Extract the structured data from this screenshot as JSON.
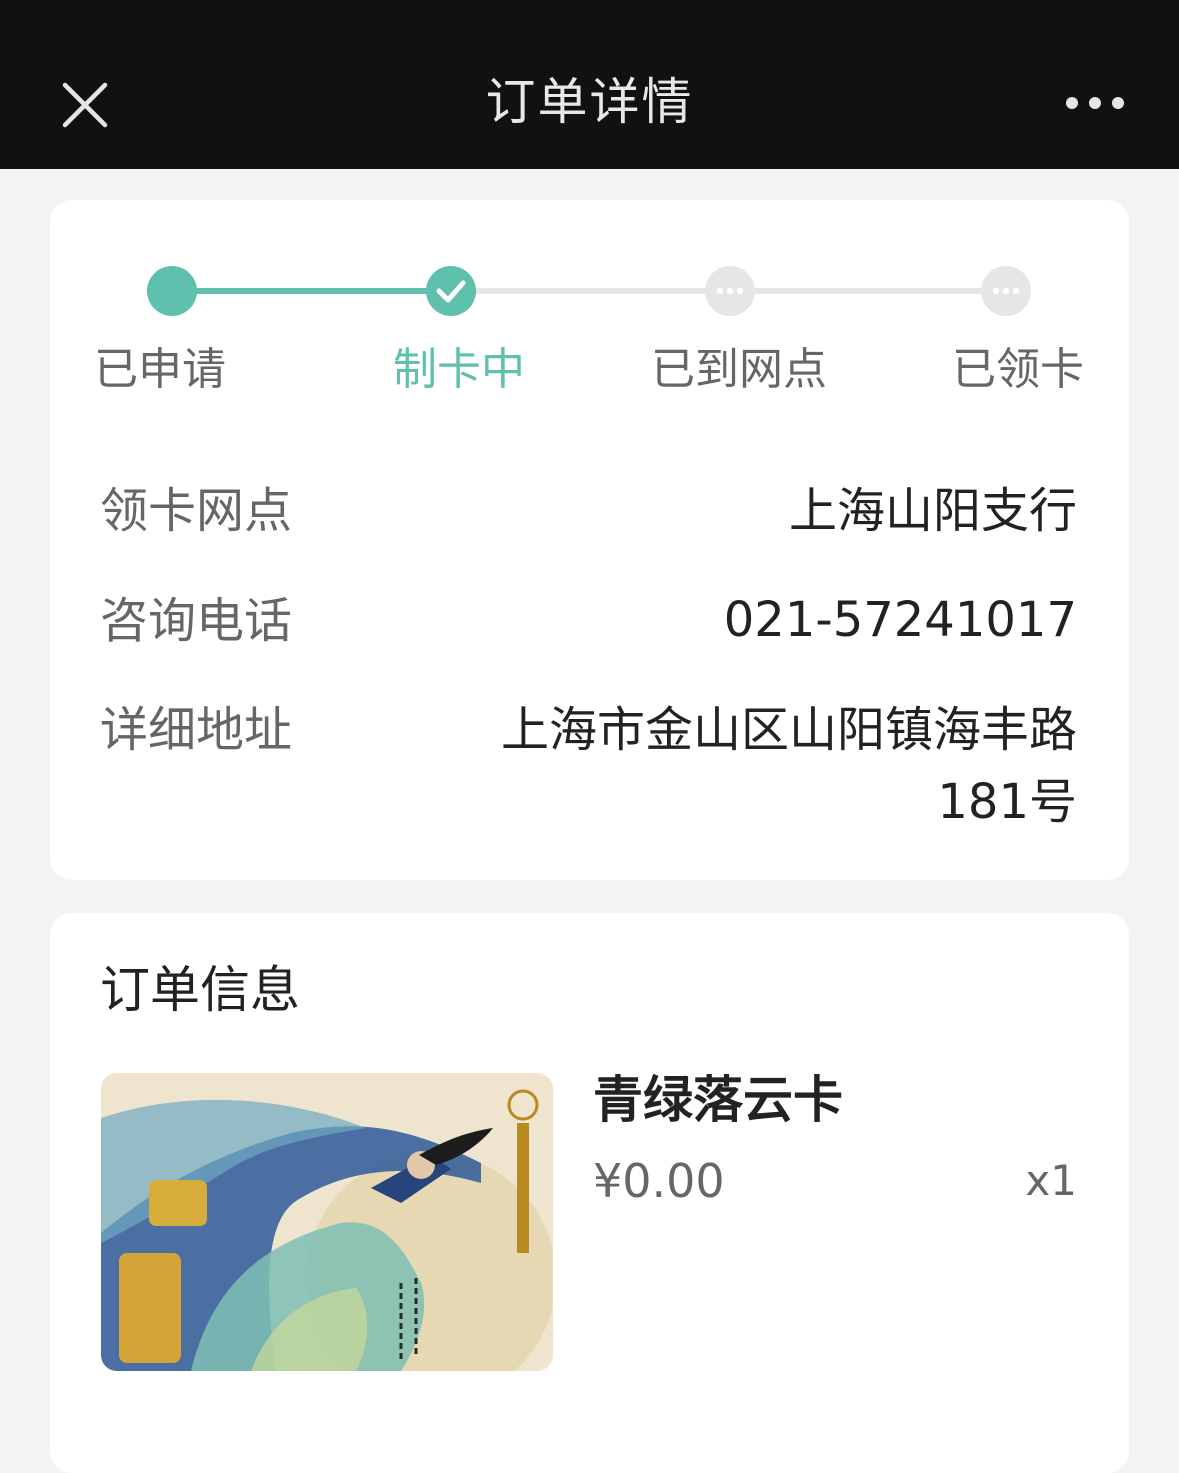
{
  "header": {
    "title": "订单详情",
    "close_icon": "close-icon",
    "more_icon": "more-dots-icon"
  },
  "progress": {
    "steps": [
      {
        "label": "已申请",
        "state": "done"
      },
      {
        "label": "制卡中",
        "state": "current"
      },
      {
        "label": "已到网点",
        "state": "pending"
      },
      {
        "label": "已领卡",
        "state": "pending"
      }
    ],
    "accent_color": "#5fc0ad",
    "pending_color": "#e6e6e6"
  },
  "pickup": {
    "branch_label": "领卡网点",
    "branch_value": "上海山阳支行",
    "phone_label": "咨询电话",
    "phone_value": "021-57241017",
    "address_label": "详细地址",
    "address_value": "上海市金山区山阳镇海丰路181号"
  },
  "order": {
    "section_title": "订单信息",
    "product_name": "青绿落云卡",
    "price": "¥0.00",
    "quantity": "x1",
    "card_brand_icon": "unionpay-logo",
    "bank_logo": "abc-bank-logo"
  }
}
